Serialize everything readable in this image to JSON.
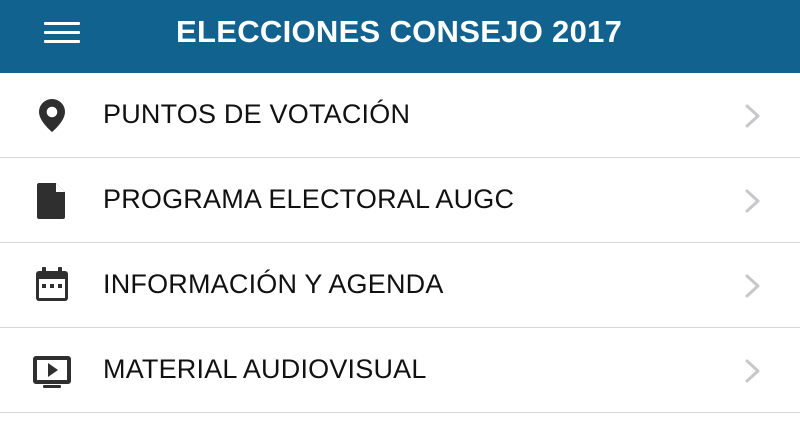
{
  "header": {
    "menu_icon": "hamburger-menu-icon",
    "title": "ELECCIONES CONSEJO 2017",
    "background_color": "#12628f",
    "title_color": "#ffffff"
  },
  "menu": {
    "items": [
      {
        "icon": "location-pin-icon",
        "label": "PUNTOS DE VOTACIÓN",
        "chevron": "chevron-right-icon"
      },
      {
        "icon": "document-icon",
        "label": "PROGRAMA ELECTORAL AUGC",
        "chevron": "chevron-right-icon"
      },
      {
        "icon": "calendar-icon",
        "label": "INFORMACIÓN Y AGENDA",
        "chevron": "chevron-right-icon"
      },
      {
        "icon": "video-player-icon",
        "label": "MATERIAL AUDIOVISUAL",
        "chevron": "chevron-right-icon"
      }
    ],
    "divider_color": "#d6d6d6",
    "text_color": "#111111",
    "icon_color": "#2f2f2f",
    "chevron_color": "#c7c7cc"
  }
}
